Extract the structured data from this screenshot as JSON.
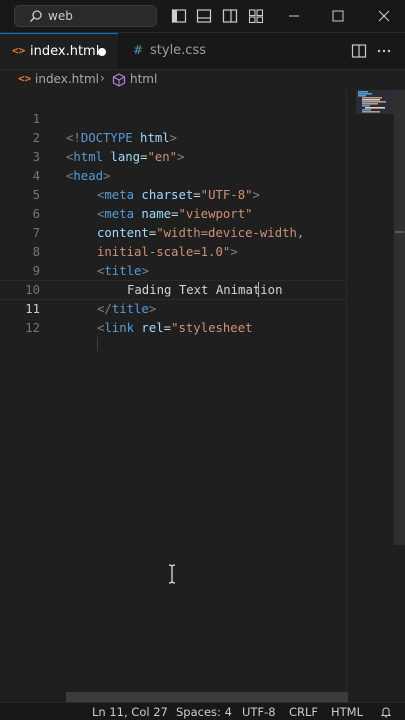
{
  "titlebar": {
    "search_text": "web",
    "icons": [
      "search-icon",
      "toggle-sidebar-icon",
      "toggle-panel-icon",
      "toggle-secondary-sidebar-icon",
      "customize-layout-icon",
      "minimize-icon",
      "maximize-icon",
      "close-icon"
    ]
  },
  "tabs": [
    {
      "label": "index.html",
      "active": true,
      "modified": true,
      "icon": "<>"
    },
    {
      "label": "style.css",
      "active": false,
      "modified": false,
      "icon": "#"
    }
  ],
  "breadcrumb": {
    "file_icon": "<>",
    "file": "index.html",
    "separator": "›",
    "symbol": "html"
  },
  "editor": {
    "line_numbers": [
      "1",
      "2",
      "3",
      "4",
      "5",
      "6",
      "7",
      "8",
      "9",
      "10",
      "11",
      "12"
    ],
    "current_line": "11",
    "lines": {
      "l1": {
        "open": "<!",
        "tag": "DOCTYPE",
        "attr": " html",
        "close": ">"
      },
      "l2": {
        "open": "<",
        "tag": "html",
        "attr": " lang",
        "eq": "=",
        "val": "\"en\"",
        "close": ">"
      },
      "l3": {
        "open": "<",
        "tag": "head",
        "close": ">"
      },
      "l4": {
        "open": "<",
        "tag": "meta",
        "attr": " charset",
        "eq": "=",
        "val": "\"UTF-8\"",
        "close": ">"
      },
      "l5": {
        "open": "<",
        "tag": "meta",
        "attr": " name",
        "eq": "=",
        "val": "\"viewport\""
      },
      "l6": {
        "attr": "content",
        "eq": "=",
        "val": "\"width=device-width,"
      },
      "l7": {
        "val": "initial-scale=1.0\"",
        "close": ">"
      },
      "l8": {
        "open": "<",
        "tag": "title",
        "close": ">"
      },
      "l9": {
        "text": "Fading Text Animation"
      },
      "l10": {
        "open": "</",
        "tag": "title",
        "close": ">"
      },
      "l11": {
        "open": "<",
        "tag": "link",
        "attr": " rel",
        "eq": "=",
        "val": "\"stylesheet"
      }
    }
  },
  "statusbar": {
    "position": "Ln 11, Col 27",
    "spaces": "Spaces: 4",
    "encoding": "UTF-8",
    "eol": "CRLF",
    "language": "HTML"
  },
  "colors": {
    "background": "#1f1f1f",
    "tag": "#569cd6",
    "attribute": "#9cdcfe",
    "string": "#ce9178",
    "accent": "#0078d4"
  }
}
